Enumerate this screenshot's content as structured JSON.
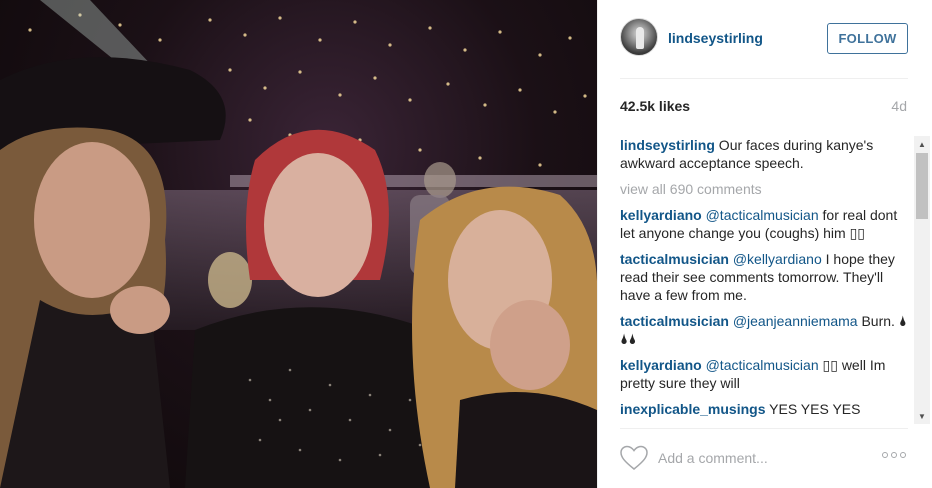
{
  "post": {
    "image_description_icon": "photo-icon"
  },
  "header": {
    "username": "lindseystirling",
    "follow_label": "FOLLOW"
  },
  "stats": {
    "likes": "42.5k likes",
    "age": "4d"
  },
  "caption": {
    "user": "lindseystirling",
    "text": " Our faces during kanye's awkward acceptance speech."
  },
  "view_all": "view all 690 comments",
  "comments": [
    {
      "user": "kellyardiano",
      "mention": "@tacticalmusician",
      "text": " for real dont let anyone change you (coughs) him ▯▯"
    },
    {
      "user": "tacticalmusician",
      "mention": "@kellyardiano",
      "text": " I hope they read their see comments tomorrow. They'll have a few from me."
    },
    {
      "user": "tacticalmusician",
      "mention": "@jeanjeanniemama",
      "text": " Burn. 🌢🌢🌢"
    },
    {
      "user": "kellyardiano",
      "mention": "@tacticalmusician",
      "text": " ▯▯ well Im pretty sure they will"
    },
    {
      "user": "inexplicable_musings",
      "mention": "",
      "text": " YES YES YES"
    }
  ],
  "footer": {
    "comment_placeholder": "Add a comment...",
    "heart_icon": "heart-icon",
    "more_icon": "more-options-icon"
  },
  "colors": {
    "link": "#125688",
    "follow": "#3f729b",
    "muted": "#a5a7aa",
    "text": "#262626"
  }
}
